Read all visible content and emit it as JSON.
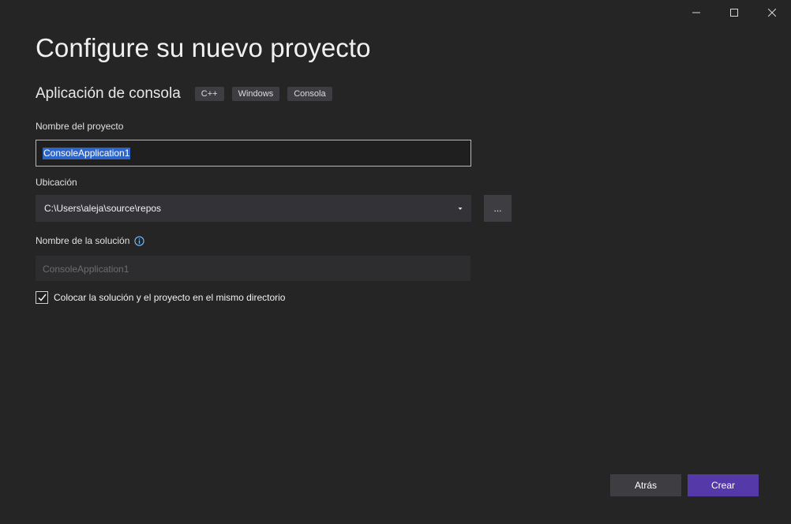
{
  "page": {
    "title": "Configure su nuevo proyecto"
  },
  "template": {
    "name": "Aplicación de consola",
    "tags": [
      "C++",
      "Windows",
      "Consola"
    ]
  },
  "project_name": {
    "label": "Nombre del proyecto",
    "value": "ConsoleApplication1"
  },
  "location": {
    "label": "Ubicación",
    "value": "C:\\Users\\aleja\\source\\repos",
    "browse_label": "..."
  },
  "solution_name": {
    "label": "Nombre de la solución",
    "value": "ConsoleApplication1"
  },
  "same_directory": {
    "label": "Colocar la solución y el proyecto en el mismo directorio",
    "checked": true
  },
  "buttons": {
    "back_label": "Atrás",
    "create_label": "Crear"
  },
  "colors": {
    "background": "#252526",
    "accent": "#5539a8",
    "selection": "#2e66c8",
    "info": "#75beff"
  },
  "icons": {
    "minimize": "minimize-icon",
    "maximize": "maximize-icon",
    "close": "close-icon",
    "dropdown": "chevron-down-icon",
    "info": "info-icon",
    "check": "checkmark-icon"
  }
}
